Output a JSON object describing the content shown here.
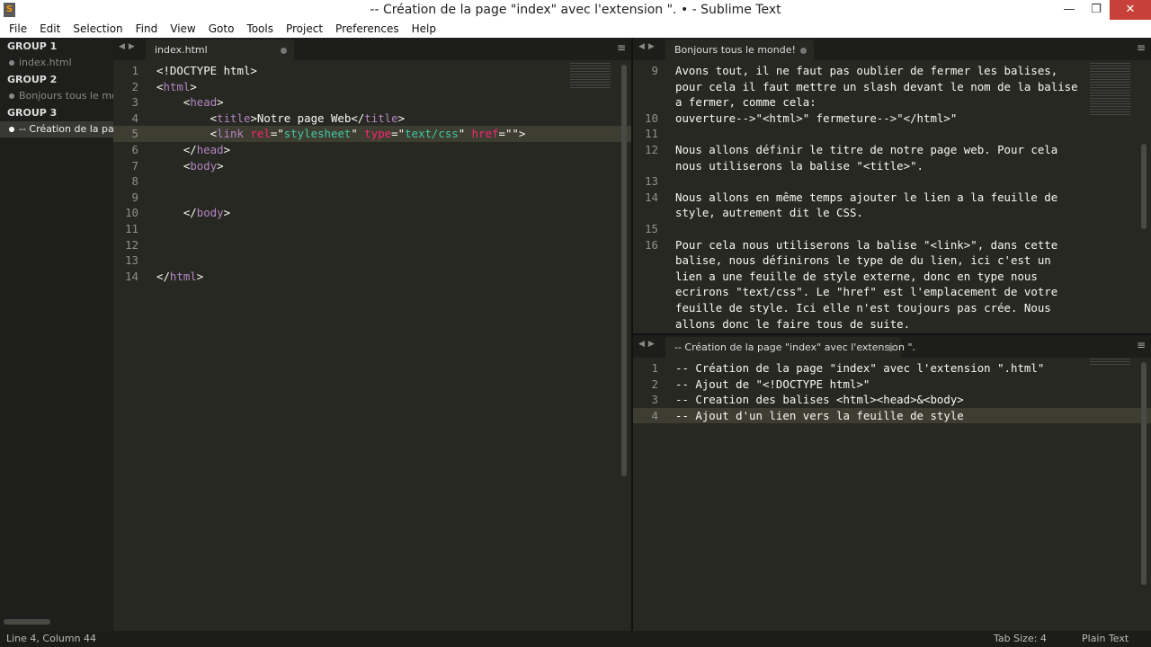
{
  "window": {
    "title": "-- Création de la page \"index\" avec l'extension \". • - Sublime Text",
    "icon": "sublime-icon",
    "minimize": "—",
    "maximize": "❐",
    "close": "✕"
  },
  "menu": [
    "File",
    "Edit",
    "Selection",
    "Find",
    "View",
    "Goto",
    "Tools",
    "Project",
    "Preferences",
    "Help"
  ],
  "sidebar": {
    "groups": [
      {
        "label": "GROUP 1",
        "item": "index.html"
      },
      {
        "label": "GROUP 2",
        "item": "Bonjours tous le monde!"
      },
      {
        "label": "GROUP 3",
        "item": "-- Création de la page \"index\" avec l'extension \"."
      }
    ]
  },
  "left_pane": {
    "tab": "index.html",
    "lines": [
      {
        "n": "1",
        "tokens": [
          [
            "",
            "<!DOCTYPE html>"
          ]
        ]
      },
      {
        "n": "2",
        "tokens": [
          [
            "",
            "<"
          ],
          [
            "tg",
            "html"
          ],
          [
            "",
            ">"
          ]
        ]
      },
      {
        "n": "3",
        "tokens": [
          [
            "",
            "    <"
          ],
          [
            "tg",
            "head"
          ],
          [
            "",
            ">"
          ]
        ]
      },
      {
        "n": "4",
        "tokens": [
          [
            "",
            "        <"
          ],
          [
            "tg",
            "title"
          ],
          [
            "",
            ">Notre page Web</"
          ],
          [
            "tg",
            "title"
          ],
          [
            "",
            ">"
          ]
        ]
      },
      {
        "n": "5",
        "tokens": [
          [
            "",
            "        <"
          ],
          [
            "tg",
            "link"
          ],
          [
            "",
            " "
          ],
          [
            "at",
            "rel"
          ],
          [
            "",
            "=\""
          ],
          [
            "st",
            "stylesheet"
          ],
          [
            "",
            "\" "
          ],
          [
            "at",
            "type"
          ],
          [
            "",
            "=\""
          ],
          [
            "st",
            "text/css"
          ],
          [
            "",
            "\" "
          ],
          [
            "at",
            "href"
          ],
          [
            "",
            "=\"\">"
          ]
        ]
      },
      {
        "n": "6",
        "tokens": [
          [
            "",
            "    </"
          ],
          [
            "tg",
            "head"
          ],
          [
            "",
            ">"
          ]
        ]
      },
      {
        "n": "7",
        "tokens": [
          [
            "",
            "    <"
          ],
          [
            "tg",
            "body"
          ],
          [
            "",
            ">"
          ]
        ]
      },
      {
        "n": "8",
        "tokens": []
      },
      {
        "n": "9",
        "tokens": []
      },
      {
        "n": "10",
        "tokens": [
          [
            "",
            "    </"
          ],
          [
            "tg",
            "body"
          ],
          [
            "",
            ">"
          ]
        ]
      },
      {
        "n": "11",
        "tokens": []
      },
      {
        "n": "12",
        "tokens": []
      },
      {
        "n": "13",
        "tokens": []
      },
      {
        "n": "14",
        "tokens": [
          [
            "",
            "</"
          ],
          [
            "tg",
            "html"
          ],
          [
            "",
            ">"
          ]
        ]
      }
    ]
  },
  "top_right_pane": {
    "tab": "Bonjours tous le monde!",
    "lines": [
      {
        "n": "9",
        "text": "Avons tout, il ne faut pas oublier de fermer les balises,"
      },
      {
        "n": "",
        "text": "pour cela il faut mettre un slash devant le nom de la balise"
      },
      {
        "n": "",
        "text": "a fermer, comme cela:"
      },
      {
        "n": "10",
        "text": "ouverture-->\"<html>\" fermeture-->\"</html>\""
      },
      {
        "n": "11",
        "text": ""
      },
      {
        "n": "12",
        "text": "Nous allons définir le titre de notre page web. Pour cela"
      },
      {
        "n": "",
        "text": "nous utiliserons la balise \"<title>\"."
      },
      {
        "n": "13",
        "text": ""
      },
      {
        "n": "14",
        "text": "Nous allons en même temps ajouter le lien a la feuille de"
      },
      {
        "n": "",
        "text": "style, autrement dit le CSS."
      },
      {
        "n": "15",
        "text": ""
      },
      {
        "n": "16",
        "text": "Pour cela nous utiliserons la balise \"<link>\", dans cette"
      },
      {
        "n": "",
        "text": "balise, nous définirons le type de du lien, ici c'est un"
      },
      {
        "n": "",
        "text": "lien a une feuille de style externe, donc en type nous"
      },
      {
        "n": "",
        "text": "ecrirons \"text/css\". Le \"href\" est l'emplacement de votre"
      },
      {
        "n": "",
        "text": "feuille de style. Ici elle n'est toujours pas crée. Nous"
      },
      {
        "n": "",
        "text": "allons donc le faire tous de suite."
      }
    ]
  },
  "bottom_right_pane": {
    "tab": "-- Création de la page \"index\" avec l'extension \".",
    "lines": [
      {
        "n": "1",
        "text": "-- Création de la page \"index\" avec l'extension \".html\""
      },
      {
        "n": "2",
        "text": "-- Ajout de \"<!DOCTYPE html>\""
      },
      {
        "n": "3",
        "text": "-- Creation des balises <html><head>&<body>"
      },
      {
        "n": "4",
        "text": "-- Ajout d'un lien vers la feuille de style"
      }
    ]
  },
  "status": {
    "position": "Line 4, Column 44",
    "tab_size": "Tab Size: 4",
    "syntax": "Plain Text"
  }
}
